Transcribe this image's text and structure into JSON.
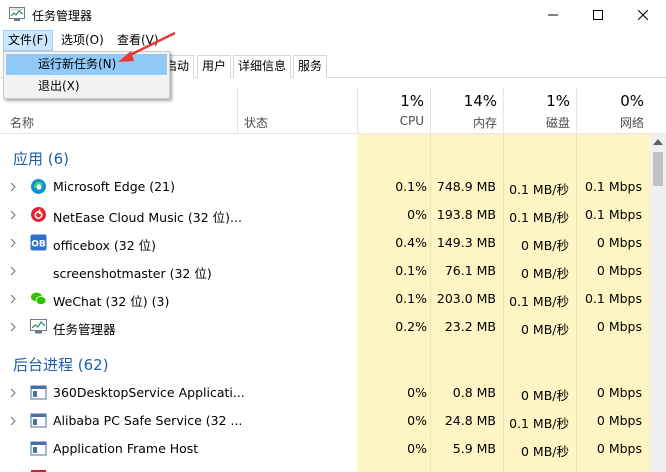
{
  "window": {
    "title": "任务管理器",
    "controls": [
      "minimize",
      "maximize",
      "close"
    ]
  },
  "menubar": {
    "items": [
      "文件(F)",
      "选项(O)",
      "查看(V)"
    ]
  },
  "tabs": [
    "启动",
    "用户",
    "详细信息",
    "服务"
  ],
  "file_menu": {
    "items": [
      "运行新任务(N)",
      "退出(X)"
    ]
  },
  "columns": {
    "name": "名称",
    "status": "状态",
    "cpu": {
      "pct": "1%",
      "label": "CPU"
    },
    "memory": {
      "pct": "14%",
      "label": "内存"
    },
    "disk": {
      "pct": "1%",
      "label": "磁盘"
    },
    "network": {
      "pct": "0%",
      "label": "网络"
    }
  },
  "groups": {
    "apps": "应用 (6)",
    "background": "后台进程 (62)"
  },
  "apps": [
    {
      "name": "Microsoft Edge (21)",
      "cpu": "0.1%",
      "memory": "748.9 MB",
      "disk": "0.1 MB/秒",
      "network": "0.1 Mbps",
      "icon": "edge-icon"
    },
    {
      "name": "NetEase Cloud Music (32 位)...",
      "cpu": "0%",
      "memory": "193.8 MB",
      "disk": "0.1 MB/秒",
      "network": "0.1 Mbps",
      "icon": "netease-music-icon"
    },
    {
      "name": "officebox (32 位)",
      "cpu": "0.4%",
      "memory": "149.3 MB",
      "disk": "0 MB/秒",
      "network": "0 Mbps",
      "icon": "officebox-icon"
    },
    {
      "name": "screenshotmaster (32 位)",
      "cpu": "0.1%",
      "memory": "76.1 MB",
      "disk": "0 MB/秒",
      "network": "0 Mbps",
      "icon": ""
    },
    {
      "name": "WeChat (32 位) (3)",
      "cpu": "0.1%",
      "memory": "203.0 MB",
      "disk": "0.1 MB/秒",
      "network": "0.1 Mbps",
      "icon": "wechat-icon"
    },
    {
      "name": "任务管理器",
      "cpu": "0.2%",
      "memory": "23.2 MB",
      "disk": "0 MB/秒",
      "network": "0 Mbps",
      "icon": "task-manager-icon"
    }
  ],
  "background": [
    {
      "name": "360DesktopService Applicati...",
      "cpu": "0%",
      "memory": "0.8 MB",
      "disk": "0 MB/秒",
      "network": "0 Mbps",
      "icon": "window-app-icon"
    },
    {
      "name": "Alibaba PC Safe Service (32 ...",
      "cpu": "0%",
      "memory": "24.8 MB",
      "disk": "0.1 MB/秒",
      "network": "0 Mbps",
      "icon": "window-app-icon"
    },
    {
      "name": "Application Frame Host",
      "cpu": "0%",
      "memory": "5.9 MB",
      "disk": "0 MB/秒",
      "network": "0 Mbps",
      "icon": "window-app-icon"
    }
  ],
  "colors": {
    "usage_bg": "#fff4c4",
    "group_title": "#1f5ea8",
    "menu_hover": "#91c9f7",
    "annotation_arrow": "#e53935"
  }
}
